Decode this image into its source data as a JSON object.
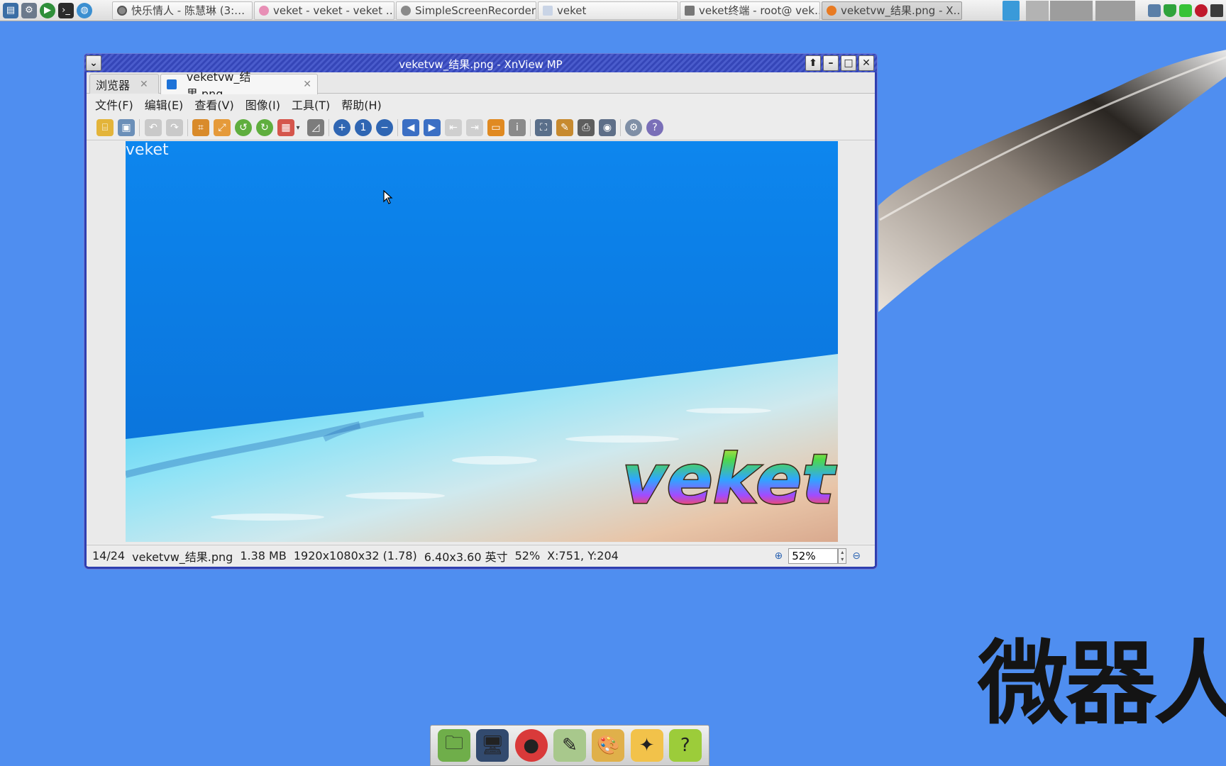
{
  "taskbar": {
    "launchers": [
      {
        "icon": "system-monitor-icon"
      },
      {
        "icon": "settings-gears-icon"
      },
      {
        "icon": "media-player-icon"
      },
      {
        "icon": "terminal-icon"
      },
      {
        "icon": "globe-icon"
      }
    ],
    "tasks": [
      {
        "label": "快乐情人 - 陈慧琳 (3:…",
        "icon": "music-icon",
        "active": false
      },
      {
        "label": "veket - veket - veket …",
        "icon": "browser-icon",
        "active": false
      },
      {
        "label": "SimpleScreenRecorder",
        "icon": "recorder-icon",
        "active": false
      },
      {
        "label": "veket",
        "icon": "folder-icon",
        "active": false
      },
      {
        "label": "veket终端 - root@ vek…",
        "icon": "terminal-icon",
        "active": false
      },
      {
        "label": "veketvw_结果.png - X…",
        "icon": "xnview-icon",
        "active": true
      }
    ]
  },
  "window": {
    "title": "veketvw_结果.png - XnView MP",
    "tabs": [
      {
        "label": "浏览器"
      },
      {
        "label": "veketvw_结果.png"
      }
    ],
    "menu": [
      "文件(F)",
      "编辑(E)",
      "查看(V)",
      "图像(I)",
      "工具(T)",
      "帮助(H)"
    ],
    "image_watermark": "veket",
    "image_logo_text": "veket",
    "status": {
      "position": "14/24",
      "filename": "veketvw_结果.png",
      "filesize": "1.38 MB",
      "dimensions": "1920x1080x32 (1.78)",
      "print_size": "6.40x3.60 英寸",
      "zoom_percent": "52%",
      "coords": "X:751, Y:204"
    },
    "zoom_value": "52%"
  },
  "desktop": {
    "big_text": "微器人"
  },
  "dock": {
    "items": [
      "file-manager-icon",
      "monitor-icon",
      "mascot-icon",
      "notes-icon",
      "paint-icon",
      "veket-mascot-icon",
      "help-icon"
    ]
  },
  "colors": {
    "desktop": "#4f8ef0",
    "titlebar": "#3546b8",
    "accent": "#2f3fb0"
  }
}
